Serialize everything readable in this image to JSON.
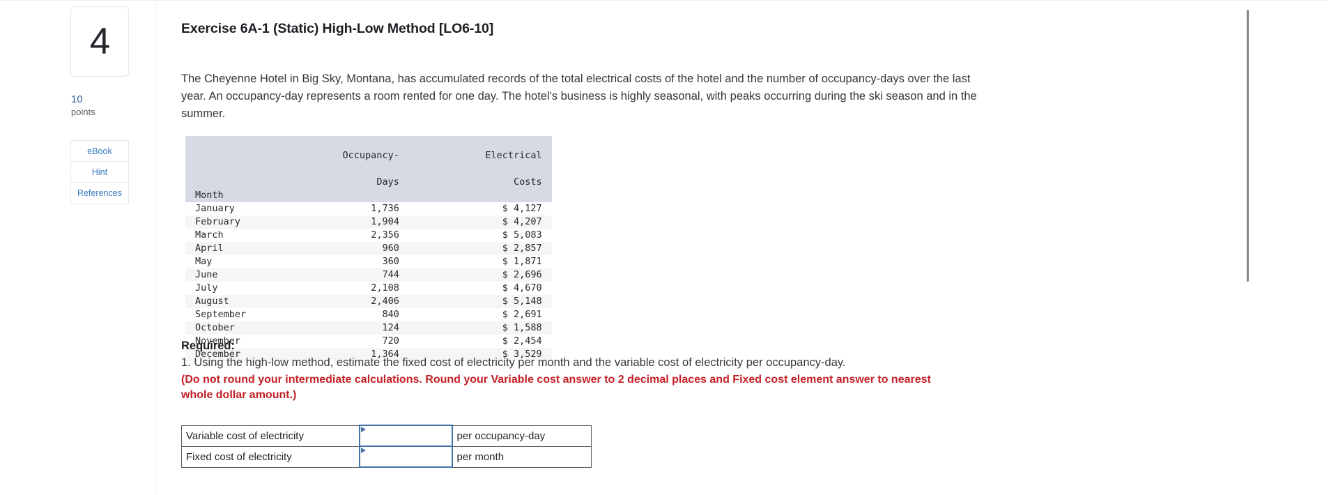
{
  "question": {
    "number": "4",
    "points_value": "10",
    "points_label": "points",
    "title": "Exercise 6A-1 (Static) High-Low Method [LO6-10]",
    "body": "The Cheyenne Hotel in Big Sky, Montana, has accumulated records of the total electrical costs of the hotel and the number of occupancy-days over the last year. An occupancy-day represents a room rented for one day. The hotel's business is highly seasonal, with peaks occurring during the ski season and in the summer."
  },
  "rail_buttons": [
    {
      "label": "eBook"
    },
    {
      "label": "Hint"
    },
    {
      "label": "References"
    }
  ],
  "data_table": {
    "headers": {
      "month": "Month",
      "days_line1": "Occupancy-",
      "days_line2": "Days",
      "cost_line1": "Electrical",
      "cost_line2": "Costs"
    },
    "rows": [
      {
        "month": "January",
        "days": "1,736",
        "cost": "$ 4,127"
      },
      {
        "month": "February",
        "days": "1,904",
        "cost": "$ 4,207"
      },
      {
        "month": "March",
        "days": "2,356",
        "cost": "$ 5,083"
      },
      {
        "month": "April",
        "days": "960",
        "cost": "$ 2,857"
      },
      {
        "month": "May",
        "days": "360",
        "cost": "$ 1,871"
      },
      {
        "month": "June",
        "days": "744",
        "cost": "$ 2,696"
      },
      {
        "month": "July",
        "days": "2,108",
        "cost": "$ 4,670"
      },
      {
        "month": "August",
        "days": "2,406",
        "cost": "$ 5,148"
      },
      {
        "month": "September",
        "days": "840",
        "cost": "$ 2,691"
      },
      {
        "month": "October",
        "days": "124",
        "cost": "$ 1,588"
      },
      {
        "month": "November",
        "days": "720",
        "cost": "$ 2,454"
      },
      {
        "month": "December",
        "days": "1,364",
        "cost": "$ 3,529"
      }
    ]
  },
  "required": {
    "heading": "Required:",
    "item_1": "1. Using the high-low method, estimate the fixed cost of electricity per month and the variable cost of electricity per occupancy-day.",
    "note": "(Do not round your intermediate calculations. Round your Variable cost answer to 2 decimal places and Fixed cost element answer to nearest whole dollar amount.)"
  },
  "answer_table": {
    "rows": [
      {
        "label": "Variable cost of electricity",
        "value": "",
        "units": "per occupancy-day"
      },
      {
        "label": "Fixed cost of electricity",
        "value": "",
        "units": "per month"
      }
    ]
  },
  "colors": {
    "accent_link": "#3a7abf",
    "points": "#2b5d9b",
    "warning_red": "#c32026",
    "table_header_bg": "#d5dae4",
    "input_border": "#4573a8"
  }
}
